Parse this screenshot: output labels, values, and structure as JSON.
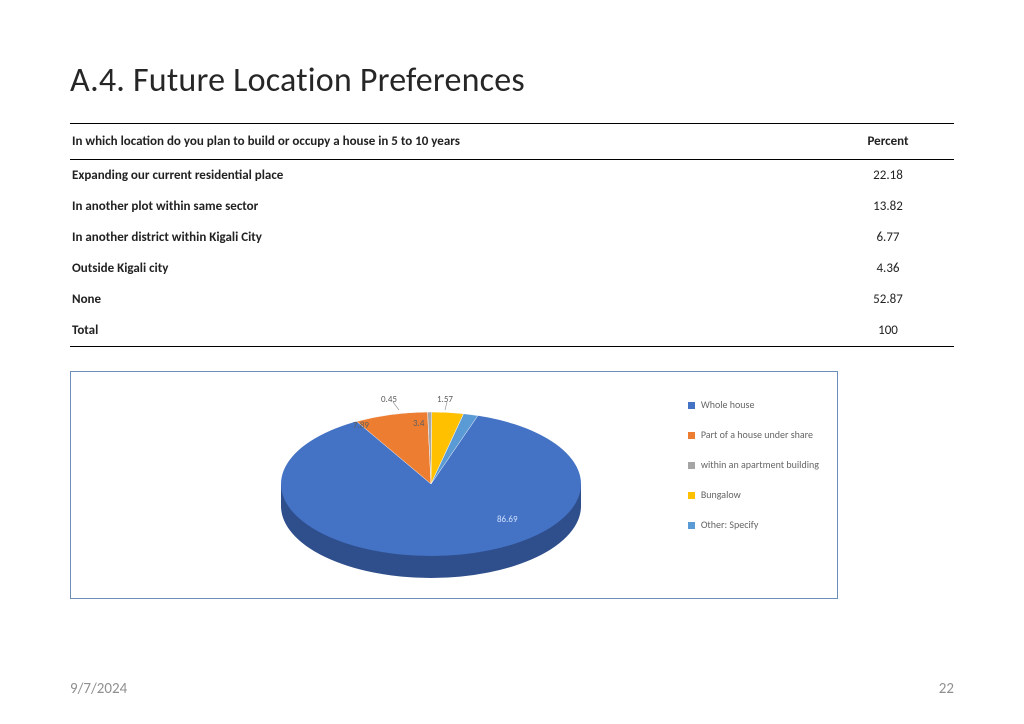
{
  "title": "A.4. Future Location Preferences",
  "table": {
    "question": "In which location do you plan to build or occupy a house in 5 to 10 years",
    "pct_header": "Percent",
    "rows": [
      {
        "label": "Expanding our current residential place",
        "pct": "22.18"
      },
      {
        "label": "In another plot within same sector",
        "pct": "13.82"
      },
      {
        "label": "In another district within Kigali City",
        "pct": "6.77"
      },
      {
        "label": "Outside Kigali city",
        "pct": "4.36"
      },
      {
        "label": "None",
        "pct": "52.87"
      },
      {
        "label": "Total",
        "pct": "100"
      }
    ]
  },
  "chart_data": {
    "type": "pie",
    "title": "",
    "series": [
      {
        "name": "Whole house",
        "value": 86.69,
        "color": "#4472c4"
      },
      {
        "name": "Part of a house under share",
        "value": 7.89,
        "color": "#ed7d31"
      },
      {
        "name": "within an apartment building",
        "value": 0.45,
        "color": "#a5a5a5"
      },
      {
        "name": "Bungalow",
        "value": 3.4,
        "color": "#ffc000"
      },
      {
        "name": "Other: Specify",
        "value": 1.57,
        "color": "#5b9bd5"
      }
    ],
    "labels": {
      "main": "86.69",
      "orange": "7.89",
      "grey": "0.45",
      "yellow": "3.4",
      "light": "1.57"
    }
  },
  "footer": {
    "date": "9/7/2024",
    "page": "22"
  }
}
